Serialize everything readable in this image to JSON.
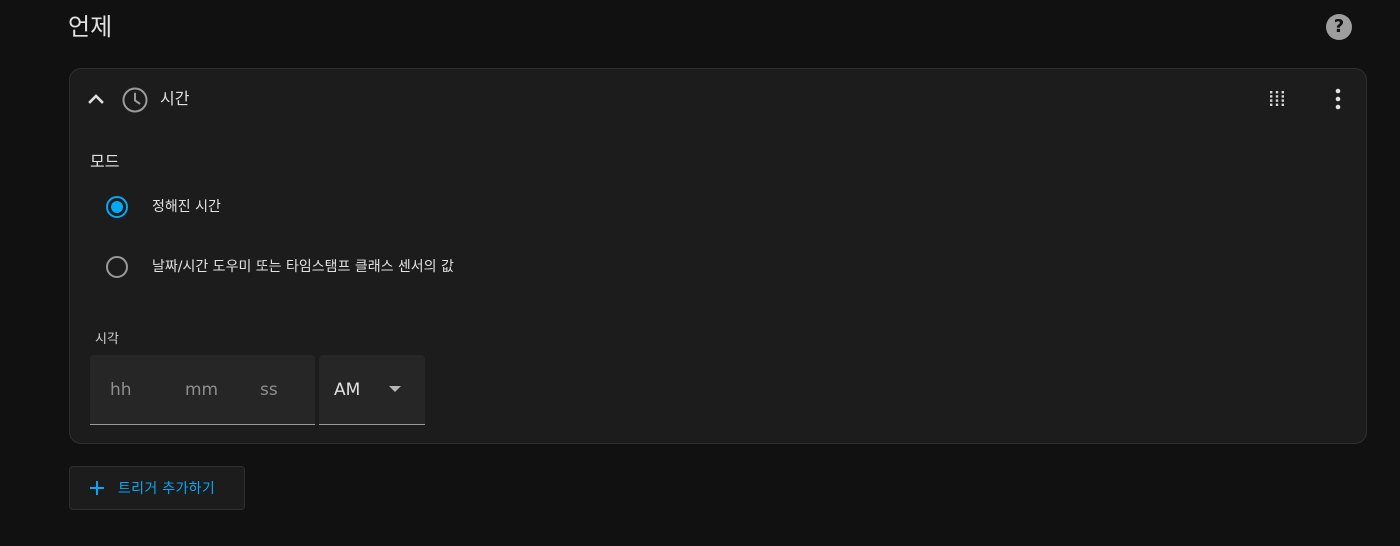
{
  "section": {
    "title": "언제",
    "help_icon": "help-circle-icon"
  },
  "trigger": {
    "icon": "clock-icon",
    "title": "시간",
    "mode_label": "모드",
    "modes": [
      {
        "label": "정해진 시간",
        "selected": true
      },
      {
        "label": "날짜/시간 도우미 또는 타임스탬프 클래스 센서의 값",
        "selected": false
      }
    ],
    "time_label": "시각",
    "time_fields": {
      "hh_placeholder": "hh",
      "mm_placeholder": "mm",
      "ss_placeholder": "ss"
    },
    "ampm": {
      "value": "AM"
    }
  },
  "add_button": {
    "label": "트리거 추가하기",
    "icon": "plus-icon"
  },
  "colors": {
    "accent": "#03a9f4",
    "background": "#111111",
    "card": "#1c1c1c"
  }
}
